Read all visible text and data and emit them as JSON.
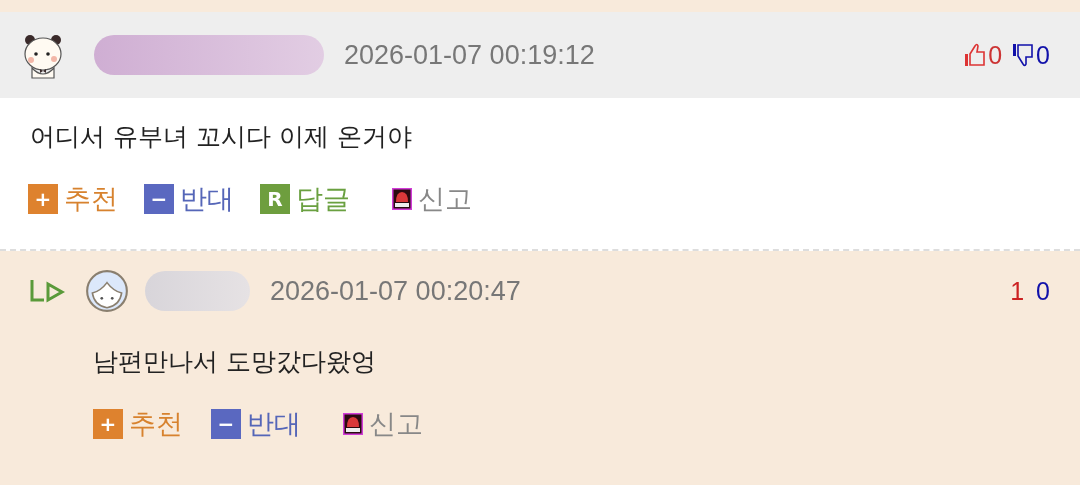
{
  "comments": [
    {
      "kind": "comment",
      "time": "2026-01-07 00:19:12",
      "votes": {
        "up": "0",
        "down": "0",
        "icons": true
      },
      "body": "어디서 유부녀 꼬시다 이제 온거야",
      "actions": [
        {
          "kind": "recommend",
          "icon": "+",
          "label": "추천"
        },
        {
          "kind": "oppose",
          "icon": "−",
          "label": "반대"
        },
        {
          "kind": "reply",
          "icon": "R",
          "label": "답글"
        },
        {
          "kind": "report",
          "label": "신고"
        }
      ]
    },
    {
      "kind": "reply",
      "time": "2026-01-07 00:20:47",
      "votes": {
        "up": "1",
        "down": "0",
        "icons": false
      },
      "body": "남편만나서 도망갔다왔엉",
      "actions": [
        {
          "kind": "recommend",
          "icon": "+",
          "label": "추천"
        },
        {
          "kind": "oppose",
          "icon": "−",
          "label": "반대"
        },
        {
          "kind": "report",
          "label": "신고"
        }
      ]
    }
  ]
}
